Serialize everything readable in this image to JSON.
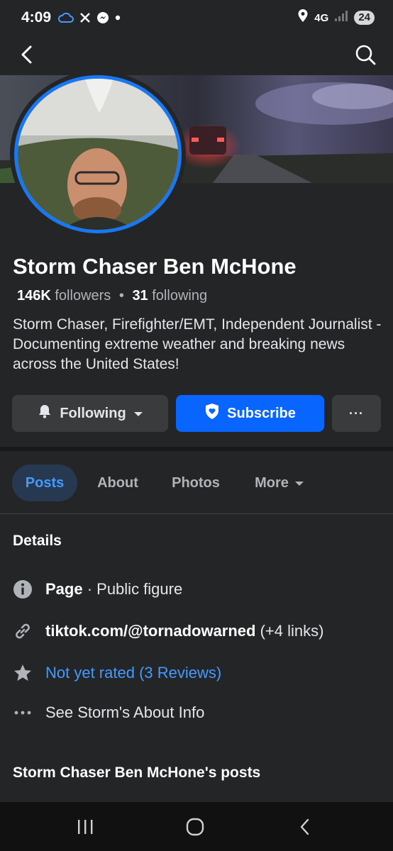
{
  "status_bar": {
    "time": "4:09",
    "network": "4G",
    "battery": "24",
    "icons": [
      "cloud-icon",
      "x-icon",
      "messenger-icon",
      "dot-icon",
      "location-icon",
      "signal-icon"
    ]
  },
  "top_nav": {
    "icons": [
      "back-arrow-icon",
      "search-icon"
    ]
  },
  "profile": {
    "name": "Storm Chaser Ben McHone",
    "followers_count": "146K",
    "followers_label": "followers",
    "separator": "•",
    "following_count": "31",
    "following_label": "following",
    "bio": "Storm Chaser, Firefighter/EMT, Independent Journalist - Documenting extreme weather and breaking news across the United States!"
  },
  "actions": {
    "following_label": "Following",
    "subscribe_label": "Subscribe",
    "more_label": "···"
  },
  "tabs": [
    {
      "label": "Posts",
      "active": true
    },
    {
      "label": "About",
      "active": false
    },
    {
      "label": "Photos",
      "active": false
    },
    {
      "label": "More",
      "active": false
    }
  ],
  "details": {
    "title": "Details",
    "page_bold": "Page",
    "page_rest": " · Public figure",
    "link_bold": "tiktok.com/@tornadowarned",
    "link_rest": " (+4 links)",
    "rating": "Not yet rated (3 Reviews)",
    "about": "See Storm's About Info"
  },
  "posts_title": "Storm Chaser Ben McHone's posts",
  "colors": {
    "background": "#242526",
    "accent": "#0866ff",
    "link": "#4599ff",
    "secondary_button": "#3a3b3c"
  }
}
